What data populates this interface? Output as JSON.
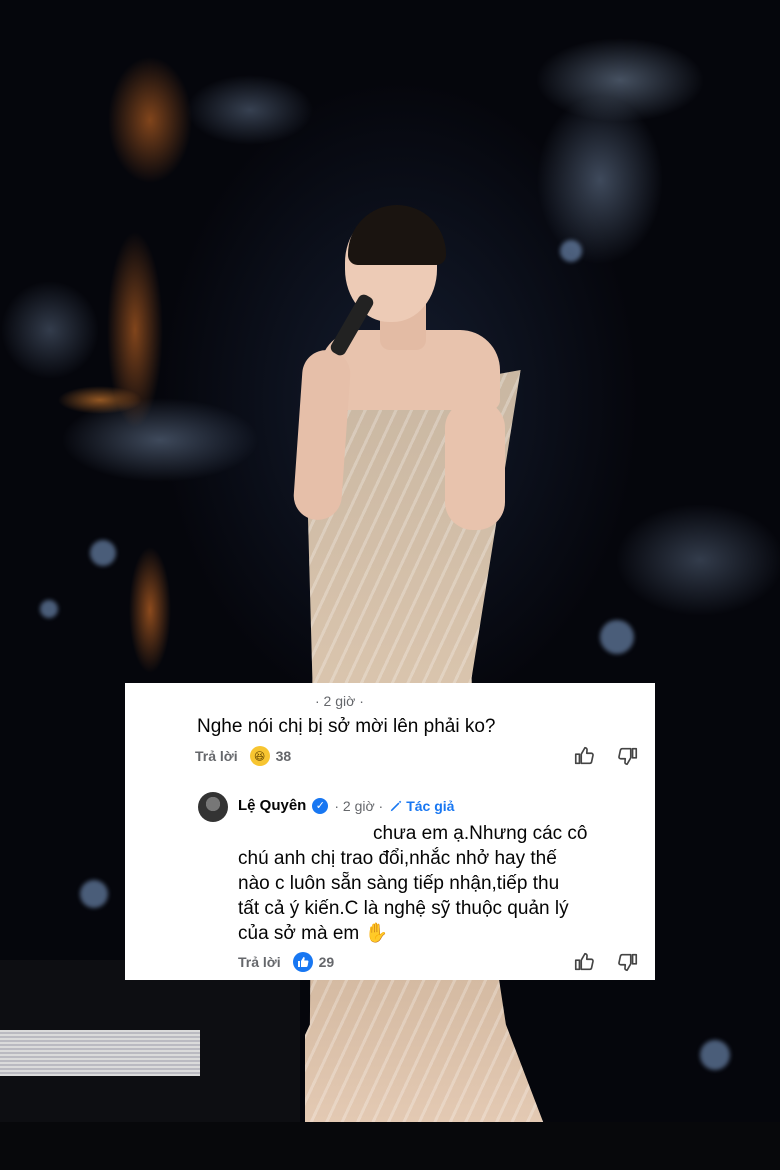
{
  "comment": {
    "time": "· 2 giờ ·",
    "text": "Nghe nói chị bị sở mời lên phải ko?",
    "reply_label": "Trả lời",
    "reaction_icon": "laughing-emoji-icon",
    "reaction_count": "38"
  },
  "reply": {
    "author_name": "Lệ Quyên",
    "time": "· 2 giờ ·",
    "author_badge": "Tác giả",
    "lines": [
      "chưa em ạ.Nhưng các cô",
      "chú anh chị trao đổi,nhắc nhở hay thế",
      "nào c luôn sẵn sàng tiếp nhận,tiếp thu",
      "tất cả ý kiến.C là nghệ sỹ thuộc quản lý",
      "của sở mà em"
    ],
    "end_emoji": "✋",
    "reply_label": "Trả lời",
    "reaction_icon": "like-icon",
    "reaction_count": "29"
  },
  "colors": {
    "accent": "#1877f2",
    "meta_text": "#65676b",
    "body_text": "#050505"
  }
}
